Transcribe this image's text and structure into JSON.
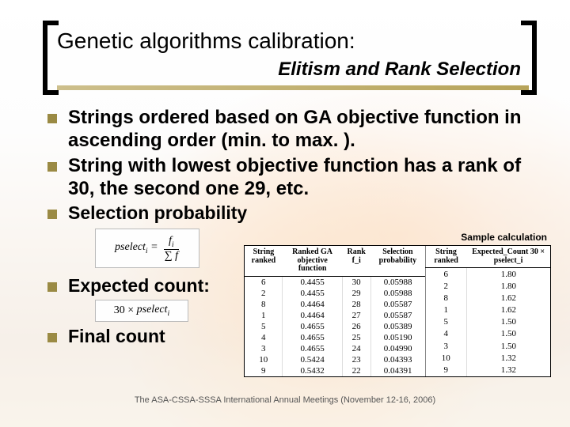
{
  "header": {
    "title": "Genetic algorithms calibration:",
    "subtitle": "Elitism and Rank Selection"
  },
  "bullets": {
    "b1": "Strings ordered based on GA objective function in ascending order (min. to max. ).",
    "b2": "String with lowest objective function has a rank of 30, the second one 29, etc.",
    "b3": "Selection probability",
    "b4": "Expected count:",
    "b5": "Final count"
  },
  "formula1": {
    "lhs": "pselect",
    "sub": "i",
    "num": "f",
    "numsub": "i",
    "den": "∑ f"
  },
  "formula2": {
    "coeff": "30 ×",
    "var": "pselect",
    "sub": "i"
  },
  "panel": {
    "title": "Sample calculation",
    "tableA": {
      "headers": [
        "String ranked",
        "Ranked GA objective function",
        "Rank f_i",
        "Selection probability"
      ],
      "rows": [
        [
          "6",
          "0.4455",
          "30",
          "0.05988"
        ],
        [
          "2",
          "0.4455",
          "29",
          "0.05988"
        ],
        [
          "8",
          "0.4464",
          "28",
          "0.05587"
        ],
        [
          "1",
          "0.4464",
          "27",
          "0.05587"
        ],
        [
          "5",
          "0.4655",
          "26",
          "0.05389"
        ],
        [
          "4",
          "0.4655",
          "25",
          "0.05190"
        ],
        [
          "3",
          "0.4655",
          "24",
          "0.04990"
        ],
        [
          "10",
          "0.5424",
          "23",
          "0.04393"
        ],
        [
          "9",
          "0.5432",
          "22",
          "0.04391"
        ]
      ]
    },
    "tableB": {
      "headers": [
        "String ranked",
        "Expected_Count 30 × pselect_i"
      ],
      "rows": [
        [
          "6",
          "1.80"
        ],
        [
          "2",
          "1.80"
        ],
        [
          "8",
          "1.62"
        ],
        [
          "1",
          "1.62"
        ],
        [
          "5",
          "1.50"
        ],
        [
          "4",
          "1.50"
        ],
        [
          "3",
          "1.50"
        ],
        [
          "10",
          "1.32"
        ],
        [
          "9",
          "1.32"
        ]
      ]
    }
  },
  "footnote": "The ASA-CSSA-SSSA International Annual Meetings (November 12-16, 2006)",
  "chart_data": [
    {
      "type": "table",
      "title": "Sample calculation — left table",
      "columns": [
        "String ranked",
        "Ranked GA objective function",
        "Rank f_i",
        "Selection probability"
      ],
      "rows": [
        [
          6,
          0.4455,
          30,
          0.05988
        ],
        [
          2,
          0.4455,
          29,
          0.05988
        ],
        [
          8,
          0.4464,
          28,
          0.05587
        ],
        [
          1,
          0.4464,
          27,
          0.05587
        ],
        [
          5,
          0.4655,
          26,
          0.05389
        ],
        [
          4,
          0.4655,
          25,
          0.0519
        ],
        [
          3,
          0.4655,
          24,
          0.0499
        ],
        [
          10,
          0.5424,
          23,
          0.04393
        ],
        [
          9,
          0.5432,
          22,
          0.04391
        ]
      ]
    },
    {
      "type": "table",
      "title": "Sample calculation — right table",
      "columns": [
        "String ranked",
        "Expected_Count = 30 × pselect_i"
      ],
      "rows": [
        [
          6,
          1.8
        ],
        [
          2,
          1.8
        ],
        [
          8,
          1.62
        ],
        [
          1,
          1.62
        ],
        [
          5,
          1.5
        ],
        [
          4,
          1.5
        ],
        [
          3,
          1.5
        ],
        [
          10,
          1.32
        ],
        [
          9,
          1.32
        ]
      ]
    }
  ]
}
